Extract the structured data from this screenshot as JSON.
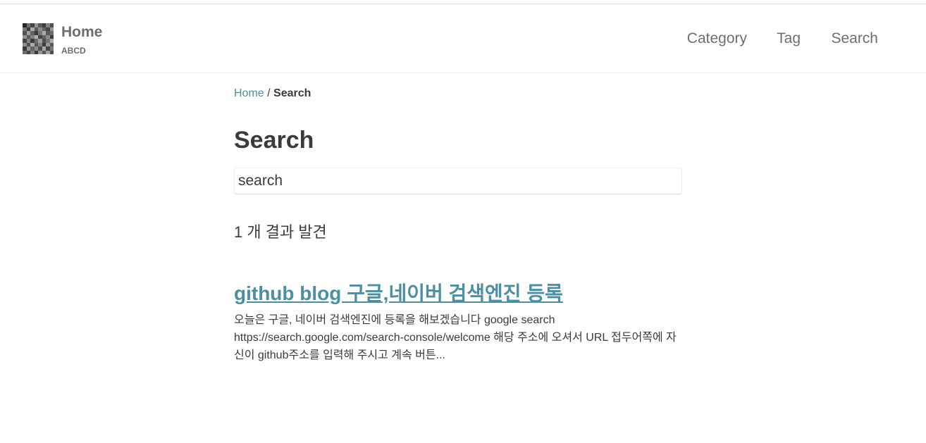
{
  "site": {
    "title": "Home",
    "subtitle": "ABCD",
    "logo_icon": "pixelated-avatar-icon"
  },
  "nav": {
    "items": [
      {
        "label": "Category"
      },
      {
        "label": "Tag"
      },
      {
        "label": "Search"
      }
    ]
  },
  "breadcrumb": {
    "home": "Home",
    "separator": " / ",
    "current": "Search"
  },
  "page": {
    "title": "Search"
  },
  "search": {
    "value": "search",
    "placeholder": ""
  },
  "results": {
    "count_text": "1 개 결과 발견",
    "items": [
      {
        "title": "github blog 구글,네이버 검색엔진 등록",
        "excerpt": "오늘은 구글, 네이버 검색엔진에 등록을 해보겠습니다 google search https://search.google.com/search-console/welcome 해당 주소에 오셔서 URL 접두어쪽에 자신이 github주소를 입력해 주시고 계속 버튼..."
      }
    ]
  },
  "colors": {
    "link": "#4a8fa3",
    "nav_text": "#6b6f72",
    "body_text": "#3b3b3b"
  }
}
